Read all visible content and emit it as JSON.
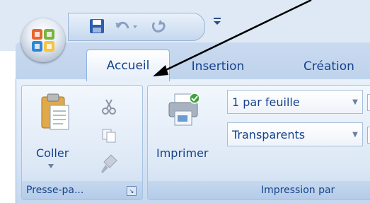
{
  "tabs": {
    "home": "Accueil",
    "insert": "Insertion",
    "create": "Création"
  },
  "clipboard": {
    "paste_label": "Coller",
    "group_label": "Presse-pa...",
    "cut_icon": "scissors-icon",
    "copy_icon": "copy-icon",
    "format_painter_icon": "format-painter-icon"
  },
  "print": {
    "print_label": "Imprimer",
    "group_label": "Impression par",
    "pages_per_sheet_value": "1 par feuille",
    "paper_type_value": "Transparents"
  },
  "colors": {
    "accent": "#15428b",
    "ribbon_bg": "#dde8f6",
    "tab_bg": "#c9daf0"
  }
}
